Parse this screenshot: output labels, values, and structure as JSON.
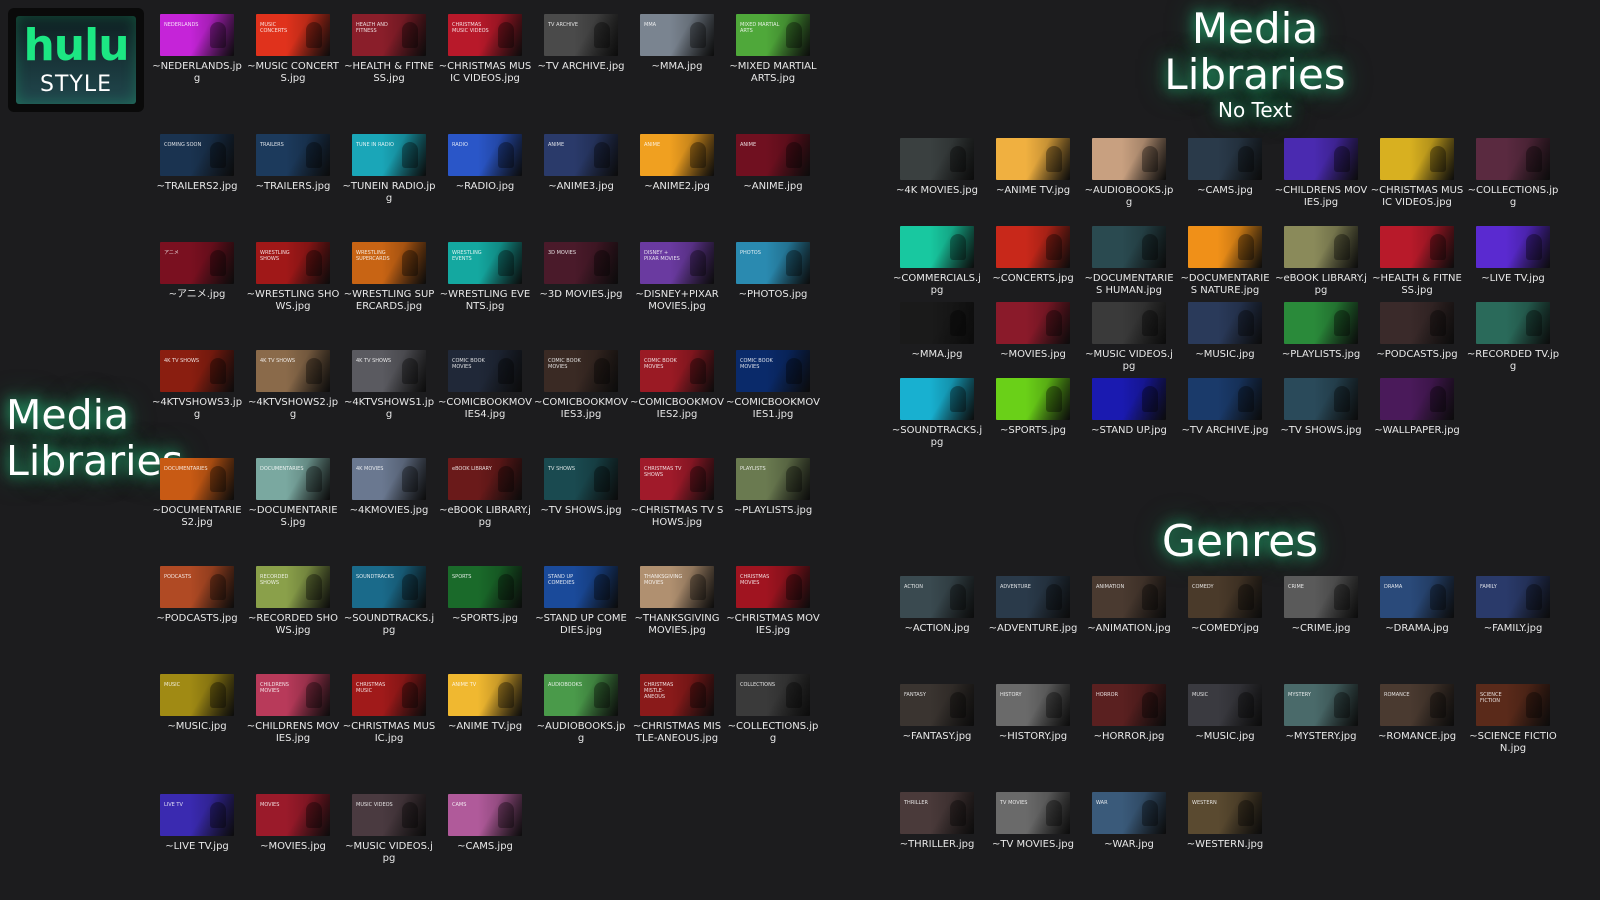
{
  "logo": {
    "word": "hulu",
    "style": "STYLE",
    "brand_color": "#1ce783"
  },
  "headings": {
    "left_title": "Media Libraries",
    "right_title": "Media Libraries",
    "right_subtitle": "No Text",
    "genres_title": "Genres"
  },
  "left_grid": [
    {
      "file": "~NEDERLANDS.jpg",
      "label": "NEDERLANDS",
      "color": "#c524d8"
    },
    {
      "file": "~MUSIC CONCERTS.jpg",
      "label": "MUSIC CONCERTS",
      "color": "#e0321c"
    },
    {
      "file": "~HEALTH & FITNESS.jpg",
      "label": "HEALTH AND FITNESS",
      "color": "#8a1e2a"
    },
    {
      "file": "~CHRISTMAS MUSIC VIDEOS.jpg",
      "label": "CHRISTMAS MUSIC VIDEOS",
      "color": "#b8192a"
    },
    {
      "file": "~TV ARCHIVE.jpg",
      "label": "TV ARCHIVE",
      "color": "#4a4a4a"
    },
    {
      "file": "~MMA.jpg",
      "label": "MMA",
      "color": "#7a8490"
    },
    {
      "file": "~MIXED MARTIAL ARTS.jpg",
      "label": "MIXED MARTIAL ARTS",
      "color": "#4fa83a"
    },
    {
      "file": "~TRAILERS2.jpg",
      "label": "COMING SOON",
      "color": "#1a3350"
    },
    {
      "file": "~TRAILERS.jpg",
      "label": "TRAILERS",
      "color": "#1c3a5c"
    },
    {
      "file": "~TUNEIN RADIO.jpg",
      "label": "TUNE IN RADIO",
      "color": "#1aa6b8"
    },
    {
      "file": "~RADIO.jpg",
      "label": "RADIO",
      "color": "#2a56c8"
    },
    {
      "file": "~ANIME3.jpg",
      "label": "ANIME",
      "color": "#2a3a6a"
    },
    {
      "file": "~ANIME2.jpg",
      "label": "ANIME",
      "color": "#f0a020"
    },
    {
      "file": "~ANIME.jpg",
      "label": "ANIME",
      "color": "#701020"
    },
    {
      "file": "~アニメ.jpg",
      "label": "アニメ",
      "color": "#7a1020"
    },
    {
      "file": "~WRESTLING SHOWS.jpg",
      "label": "WRESTLING SHOWS",
      "color": "#a01818"
    },
    {
      "file": "~WRESTLING SUPERCARDS.jpg",
      "label": "WRESTLING SUPERCARDS",
      "color": "#c86414"
    },
    {
      "file": "~WRESTLING EVENTS.jpg",
      "label": "WRESTLING EVENTS",
      "color": "#14a8a0"
    },
    {
      "file": "~3D MOVIES.jpg",
      "label": "3D MOVIES",
      "color": "#4a1a2a"
    },
    {
      "file": "~DISNEY+PIXAR MOVIES.jpg",
      "label": "DISNEY + PIXAR MOVIES",
      "color": "#6a3aa0"
    },
    {
      "file": "~PHOTOS.jpg",
      "label": "PHOTOS",
      "color": "#2a8ab0"
    },
    {
      "file": "~4KTVSHOWS3.jpg",
      "label": "4K TV SHOWS",
      "color": "#8a1e10"
    },
    {
      "file": "~4KTVSHOWS2.jpg",
      "label": "4K TV SHOWS",
      "color": "#8a6a4a"
    },
    {
      "file": "~4KTVSHOWS1.jpg",
      "label": "4K TV SHOWS",
      "color": "#5a5a60"
    },
    {
      "file": "~COMICBOOKMOVIES4.jpg",
      "label": "COMIC BOOK MOVIES",
      "color": "#202838"
    },
    {
      "file": "~COMICBOOKMOVIES3.jpg",
      "label": "COMIC BOOK MOVIES",
      "color": "#3a2a24"
    },
    {
      "file": "~COMICBOOKMOVIES2.jpg",
      "label": "COMIC BOOK MOVIES",
      "color": "#9a1a24"
    },
    {
      "file": "~COMICBOOKMOVIES1.jpg",
      "label": "COMIC BOOK MOVIES",
      "color": "#0a2a6a"
    },
    {
      "file": "~DOCUMENTARIES2.jpg",
      "label": "DOCUMENTARIES",
      "color": "#c85a14"
    },
    {
      "file": "~DOCUMENTARIES.jpg",
      "label": "DOCUMENTARIES",
      "color": "#7aa8a0"
    },
    {
      "file": "~4KMOVIES.jpg",
      "label": "4K MOVIES",
      "color": "#6a7890"
    },
    {
      "file": "~eBOOK LIBRARY.jpg",
      "label": "eBOOK LIBRARY",
      "color": "#6a1a1a"
    },
    {
      "file": "~TV SHOWS.jpg",
      "label": "TV SHOWS",
      "color": "#1a4a50"
    },
    {
      "file": "~CHRISTMAS TV SHOWS.jpg",
      "label": "CHRISTMAS TV SHOWS",
      "color": "#a01a2a"
    },
    {
      "file": "~PLAYLISTS.jpg",
      "label": "PLAYLISTS",
      "color": "#6a7a50"
    },
    {
      "file": "~PODCASTS.jpg",
      "label": "PODCASTS",
      "color": "#b04a24"
    },
    {
      "file": "~RECORDED SHOWS.jpg",
      "label": "RECORDED SHOWS",
      "color": "#8aa04a"
    },
    {
      "file": "~SOUNDTRACKS.jpg",
      "label": "SOUNDTRACKS",
      "color": "#1a6a8a"
    },
    {
      "file": "~SPORTS.jpg",
      "label": "SPORTS",
      "color": "#1a6a2a"
    },
    {
      "file": "~STAND UP COMEDIES.jpg",
      "label": "STAND UP COMEDIES",
      "color": "#1a4a9a"
    },
    {
      "file": "~THANKSGIVING MOVIES.jpg",
      "label": "THANKSGIVING MOVIES",
      "color": "#b09070"
    },
    {
      "file": "~CHRISTMAS MOVIES.jpg",
      "label": "CHRISTMAS MOVIES",
      "color": "#a01420"
    },
    {
      "file": "~MUSIC.jpg",
      "label": "MUSIC",
      "color": "#a08a14"
    },
    {
      "file": "~CHILDRENS MOVIES.jpg",
      "label": "CHILDRENS MOVIES",
      "color": "#b83a5a"
    },
    {
      "file": "~CHRISTMAS MUSIC.jpg",
      "label": "CHRISTMAS MUSIC",
      "color": "#a01a1a"
    },
    {
      "file": "~ANIME TV.jpg",
      "label": "ANIME TV",
      "color": "#f0b830"
    },
    {
      "file": "~AUDIOBOOKS.jpg",
      "label": "AUDIOBOOKS",
      "color": "#4a9a4a"
    },
    {
      "file": "~CHRISTMAS MISTLE-ANEOUS.jpg",
      "label": "CHRISTMAS MISTLE-ANEOUS",
      "color": "#8a1a1a"
    },
    {
      "file": "~COLLECTIONS.jpg",
      "label": "COLLECTIONS",
      "color": "#3a3a3a"
    },
    {
      "file": "~LIVE TV.jpg",
      "label": "LIVE TV",
      "color": "#3a2ab0"
    },
    {
      "file": "~MOVIES.jpg",
      "label": "MOVIES",
      "color": "#9a1a2a"
    },
    {
      "file": "~MUSIC VIDEOS.jpg",
      "label": "MUSIC VIDEOS",
      "color": "#4a3a40"
    },
    {
      "file": "~CAMS.jpg",
      "label": "CAMS",
      "color": "#b05a9a"
    }
  ],
  "right_grid": [
    {
      "file": "~4K MOVIES.jpg",
      "color": "#3a4040"
    },
    {
      "file": "~ANIME TV.jpg",
      "color": "#f0b040"
    },
    {
      "file": "~AUDIOBOOKS.jpg",
      "color": "#c8a080"
    },
    {
      "file": "~CAMS.jpg",
      "color": "#2a3a4a"
    },
    {
      "file": "~CHILDRENS MOVIES.jpg",
      "color": "#4a2ab0"
    },
    {
      "file": "~CHRISTMAS MUSIC VIDEOS.jpg",
      "color": "#d8b020"
    },
    {
      "file": "~COLLECTIONS.jpg",
      "color": "#5a2a40"
    },
    {
      "file": "~COMMERCIALS.jpg",
      "color": "#18c8a0"
    },
    {
      "file": "~CONCERTS.jpg",
      "color": "#c8281a"
    },
    {
      "file": "~DOCUMENTARIES HUMAN.jpg",
      "color": "#2a4a50"
    },
    {
      "file": "~DOCUMENTARIES NATURE.jpg",
      "color": "#f09018"
    },
    {
      "file": "~eBOOK LIBRARY.jpg",
      "color": "#8a8a5a"
    },
    {
      "file": "~HEALTH & FITNESS.jpg",
      "color": "#b81a2a"
    },
    {
      "file": "~LIVE TV.jpg",
      "color": "#5a2ad0"
    },
    {
      "file": "~MMA.jpg",
      "color": "#1a1a1a"
    },
    {
      "file": "~MOVIES.jpg",
      "color": "#8a1a2a"
    },
    {
      "file": "~MUSIC VIDEOS.jpg",
      "color": "#3a3a3a"
    },
    {
      "file": "~MUSIC.jpg",
      "color": "#2a3a5a"
    },
    {
      "file": "~PLAYLISTS.jpg",
      "color": "#2a8a3a"
    },
    {
      "file": "~PODCASTS.jpg",
      "color": "#3a2a2a"
    },
    {
      "file": "~RECORDED TV.jpg",
      "color": "#2a6a5a"
    },
    {
      "file": "~SOUNDTRACKS.jpg",
      "color": "#18b0d0"
    },
    {
      "file": "~SPORTS.jpg",
      "color": "#6ad018"
    },
    {
      "file": "~STAND UP.jpg",
      "color": "#1a1ab0"
    },
    {
      "file": "~TV ARCHIVE.jpg",
      "color": "#1a3a6a"
    },
    {
      "file": "~TV SHOWS.jpg",
      "color": "#2a4a5a"
    },
    {
      "file": "~WALLPAPER.jpg",
      "color": "#4a1a5a"
    }
  ],
  "genres_grid": [
    {
      "file": "~ACTION.jpg",
      "label": "ACTION",
      "color": "#3a4a50"
    },
    {
      "file": "~ADVENTURE.jpg",
      "label": "ADVENTURE",
      "color": "#2a3a4a"
    },
    {
      "file": "~ANIMATION.jpg",
      "label": "ANIMATION",
      "color": "#4a3a30"
    },
    {
      "file": "~COMEDY.jpg",
      "label": "COMEDY",
      "color": "#4a3a2a"
    },
    {
      "file": "~CRIME.jpg",
      "label": "CRIME",
      "color": "#5a5a5a"
    },
    {
      "file": "~DRAMA.jpg",
      "label": "DRAMA",
      "color": "#2a4a7a"
    },
    {
      "file": "~FAMILY.jpg",
      "label": "FAMILY",
      "color": "#2a3a6a"
    },
    {
      "file": "~FANTASY.jpg",
      "label": "FANTASY",
      "color": "#3a3430"
    },
    {
      "file": "~HISTORY.jpg",
      "label": "HISTORY",
      "color": "#6a6a6a"
    },
    {
      "file": "~HORROR.jpg",
      "label": "HORROR",
      "color": "#5a2020"
    },
    {
      "file": "~MUSIC.jpg",
      "label": "MUSIC",
      "color": "#3a3a40"
    },
    {
      "file": "~MYSTERY.jpg",
      "label": "MYSTERY",
      "color": "#4a6a6a"
    },
    {
      "file": "~ROMANCE.jpg",
      "label": "ROMANCE",
      "color": "#4a3a30"
    },
    {
      "file": "~SCIENCE FICTION.jpg",
      "label": "SCIENCE FICTION",
      "color": "#5a2a1a"
    },
    {
      "file": "~THRILLER.jpg",
      "label": "THRILLER",
      "color": "#4a3a3a"
    },
    {
      "file": "~TV MOVIES.jpg",
      "label": "TV MOVIES",
      "color": "#6a6a6a"
    },
    {
      "file": "~WAR.jpg",
      "label": "WAR",
      "color": "#3a5a7a"
    },
    {
      "file": "~WESTERN.jpg",
      "label": "WESTERN",
      "color": "#5a4a30"
    }
  ]
}
